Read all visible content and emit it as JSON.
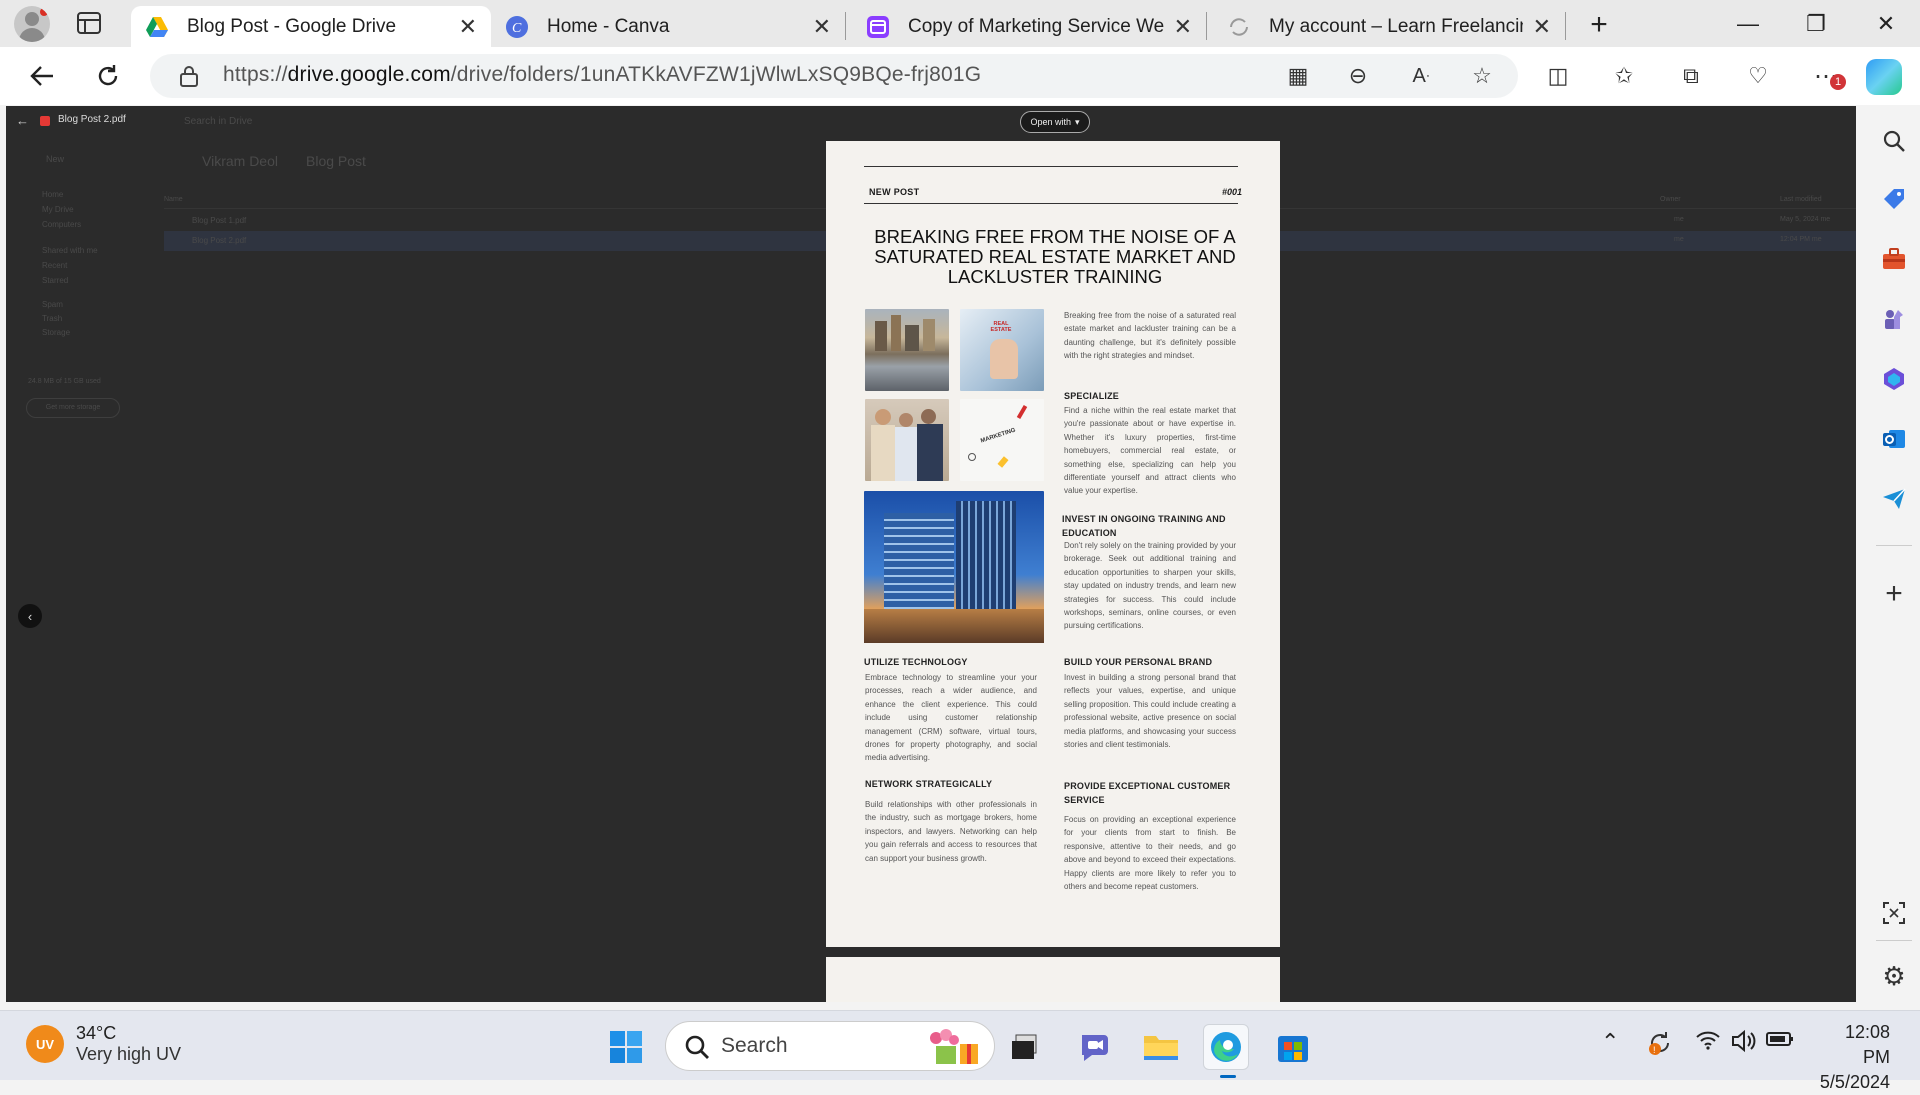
{
  "browser": {
    "tabs": [
      {
        "title": "Blog Post - Google Drive",
        "favicon": "google-drive-icon",
        "active": true
      },
      {
        "title": "Home - Canva",
        "favicon": "canva-icon",
        "active": false
      },
      {
        "title": "Copy of Marketing Service Websi",
        "favicon": "canva-design-icon",
        "active": false
      },
      {
        "title": "My account – Learn Freelancing \\",
        "favicon": "loading-icon",
        "active": false
      }
    ],
    "url_prefix": "https://",
    "url_domain": "drive.google.com",
    "url_path": "/drive/folders/1unATKkAVFZW1jWlwLxSQ9BQe-frj801G",
    "notification_badge": "1"
  },
  "drive_background": {
    "file_name": "Blog Post 2.pdf",
    "search_placeholder": "Search in Drive",
    "new_button": "New",
    "breadcrumb": [
      "Vikram Deol",
      "Blog Post"
    ],
    "nav_items": [
      "Home",
      "My Drive",
      "Computers",
      "Shared with me",
      "Recent",
      "Starred",
      "Spam",
      "Trash",
      "Storage"
    ],
    "storage_text": "24.8 MB of 15 GB used",
    "storage_button": "Get more storage",
    "column_name": "Name",
    "column_owner": "Owner",
    "column_modified": "Last modified",
    "files": [
      {
        "name": "Blog Post 1.pdf",
        "owner": "me",
        "modified": "May 5, 2024 me"
      },
      {
        "name": "Blog Post 2.pdf",
        "owner": "me",
        "modified": "12:04 PM me"
      }
    ]
  },
  "viewer": {
    "open_with_label": "Open with"
  },
  "document": {
    "tag": "NEW POST",
    "number": "#001",
    "headline": "BREAKING FREE FROM THE NOISE OF A SATURATED REAL ESTATE MARKET AND LACKLUSTER TRAINING",
    "intro": "Breaking free from the noise of a saturated real estate market and lackluster training can be a daunting challenge, but it's definitely possible with the right strategies and mindset.",
    "specialize_title": "SPECIALIZE",
    "specialize_body": "Find a niche within the real estate market that you're passionate about or have expertise in. Whether it's luxury properties, first-time homebuyers, commercial real estate, or something else, specializing can help you differentiate yourself and attract clients who value your expertise.",
    "invest_title": "INVEST IN ONGOING TRAINING AND EDUCATION",
    "invest_body": "Don't rely solely on the training provided by your brokerage. Seek out additional training and education opportunities to sharpen your skills, stay updated on industry trends, and learn new strategies for success. This could include workshops, seminars, online courses, or even pursuing certifications.",
    "tech_title": "UTILIZE TECHNOLOGY",
    "tech_body": "Embrace technology to streamline your your processes, reach a wider audience, and enhance the client experience. This could include using customer relationship management (CRM) software, virtual tours, drones for property photography, and social media advertising.",
    "brand_title": "BUILD YOUR PERSONAL BRAND",
    "brand_body": "Invest in building a strong personal brand that reflects your values, expertise, and unique selling proposition. This could include creating a professional website, active presence on social media platforms, and showcasing your success stories and client testimonials.",
    "network_title": "NETWORK STRATEGICALLY",
    "network_body": "Build relationships with other professionals in the industry, such as mortgage brokers, home inspectors, and lawyers. Networking can help you gain referrals and access to resources that can support your business growth.",
    "service_title": "PROVIDE EXCEPTIONAL CUSTOMER SERVICE",
    "service_body": "Focus on providing an exceptional experience for your clients from start to finish. Be responsive, attentive to their needs, and go above and beyond to exceed their expectations. Happy clients are more likely to refer you to others and become repeat customers.",
    "image_real_estate_label": "REAL ESTATE",
    "image_marketing_label": "MARKETING"
  },
  "taskbar": {
    "weather_badge": "UV",
    "temperature": "34°C",
    "weather_desc": "Very high UV",
    "search_label": "Search",
    "time": "12:08 PM",
    "date": "5/5/2024"
  },
  "colors": {
    "accent_blue": "#1a73e8",
    "viewer_bg": "#2b2b2b",
    "page_bg": "#f4f2ee"
  }
}
